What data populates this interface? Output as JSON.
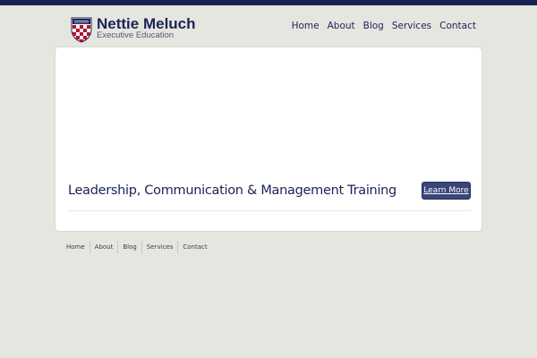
{
  "site": {
    "name": "Nettie Meluch",
    "tagline": "Executive Education",
    "logo_icon": "university-shield-icon"
  },
  "nav": {
    "items": [
      {
        "label": "Home"
      },
      {
        "label": "About"
      },
      {
        "label": "Blog"
      },
      {
        "label": "Services"
      },
      {
        "label": "Contact"
      }
    ]
  },
  "hero": {
    "headline": "Leadership, Communication & Management Training",
    "button_label": "Learn More"
  },
  "footer": {
    "nav": [
      {
        "label": "Home"
      },
      {
        "label": "About"
      },
      {
        "label": "Blog"
      },
      {
        "label": "Services"
      },
      {
        "label": "Contact"
      }
    ]
  },
  "colors": {
    "brand_navy": "#1b2356",
    "button": "#3a4579",
    "background": "#e6e6e0",
    "shield_red": "#b3132d"
  }
}
